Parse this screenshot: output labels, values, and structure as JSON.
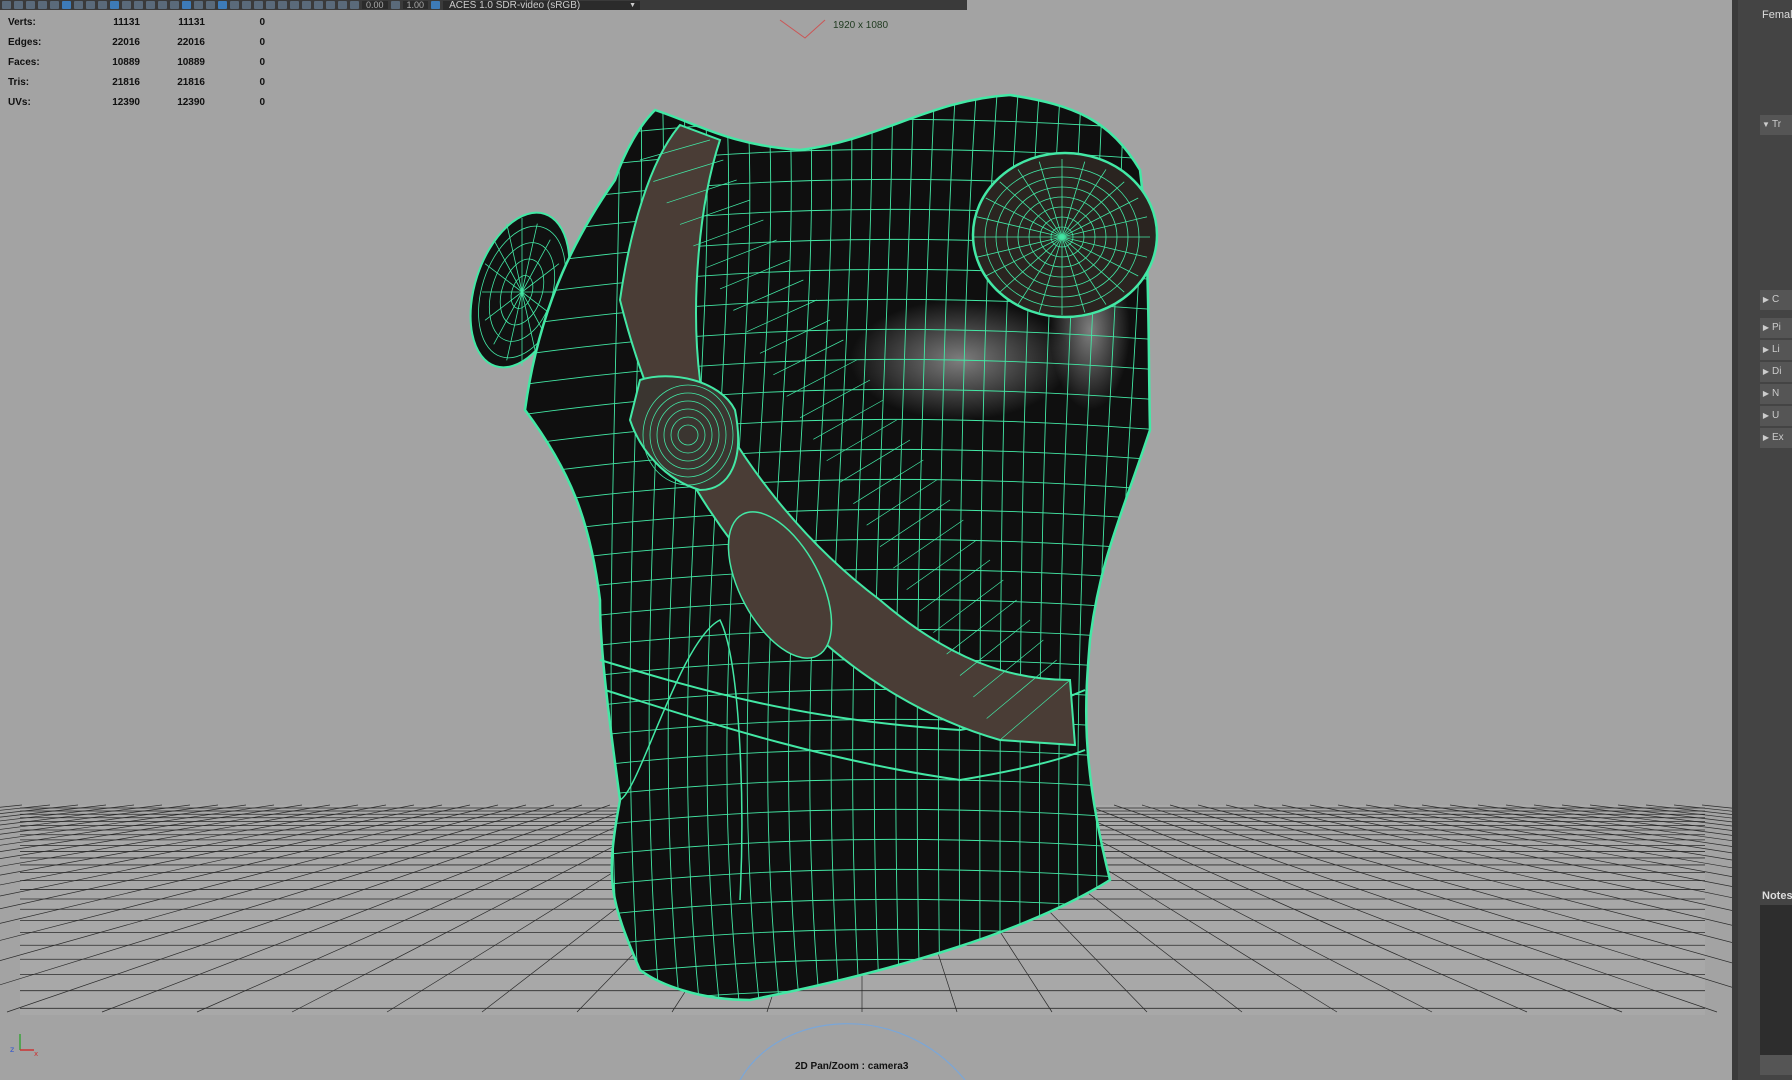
{
  "toolbar": {
    "field1": "0.00",
    "field2": "1.00",
    "color_space": "ACES 1.0 SDR-video (sRGB)"
  },
  "hud": [
    {
      "label": "Verts:",
      "v1": "11131",
      "v2": "11131",
      "v3": "0"
    },
    {
      "label": "Edges:",
      "v1": "22016",
      "v2": "22016",
      "v3": "0"
    },
    {
      "label": "Faces:",
      "v1": "10889",
      "v2": "10889",
      "v3": "0"
    },
    {
      "label": "Tris:",
      "v1": "21816",
      "v2": "21816",
      "v3": "0"
    },
    {
      "label": "UVs:",
      "v1": "12390",
      "v2": "12390",
      "v3": "0"
    }
  ],
  "resolution": "1920 x 1080",
  "camera_label": "2D Pan/Zoom : camera3",
  "panel": {
    "title": "Female",
    "sections": [
      "Tr",
      "C",
      "Pi",
      "Li",
      "Di",
      "N",
      "U",
      "Ex"
    ],
    "notes_label": "Notes:"
  },
  "colors": {
    "wireframe": "#43e8a5",
    "viewport_bg": "#a3a3a3",
    "mesh": "#0f0f0f"
  }
}
